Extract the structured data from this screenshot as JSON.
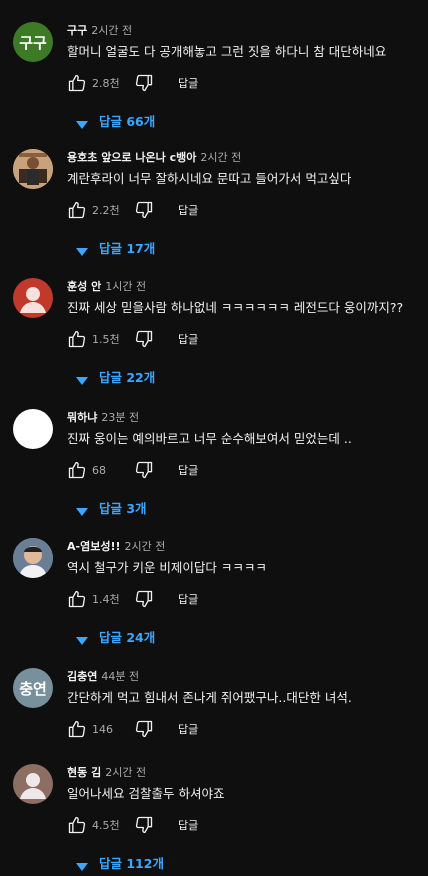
{
  "comments": [
    {
      "author": "구구",
      "time": "2시간 전",
      "text": "할머니 얼굴도 다 공개해놓고 그런 짓을 하다니 참 대단하네요",
      "likes": "2.8천",
      "reply_label": "답글",
      "replies_label": "답글 66개",
      "avatar": {
        "type": "initials",
        "initials": "구구",
        "color": "#3d7a26"
      }
    },
    {
      "author": "용호초 앞으로 나온나 c뱅아",
      "time": "2시간 전",
      "text": "계란후라이 너무 잘하시네요 문따고 들어가서 먹고싶다",
      "likes": "2.2천",
      "reply_label": "답글",
      "replies_label": "답글 17개",
      "avatar": {
        "type": "photo",
        "color": "#c7a27a"
      }
    },
    {
      "author": "훈성 안",
      "time": "1시간 전",
      "text": "진짜 세상 믿을사람 하나없네 ㅋㅋㅋㅋㅋㅋ 레전드다 웅이까지??",
      "likes": "1.5천",
      "reply_label": "답글",
      "replies_label": "답글 22개",
      "avatar": {
        "type": "default-person",
        "color": "#c0392b"
      }
    },
    {
      "author": "뭐하냐",
      "time": "23분 전",
      "text": "진짜 웅이는 예의바르고 너무 순수해보여서 믿었는데 ..",
      "likes": "68",
      "reply_label": "답글",
      "replies_label": "답글 3개",
      "avatar": {
        "type": "blank",
        "color": "#ffffff"
      }
    },
    {
      "author": "A-염보성!!",
      "time": "2시간 전",
      "text": "역시 철구가 키운 비제이답다 ㅋㅋㅋㅋ",
      "likes": "1.4천",
      "reply_label": "답글",
      "replies_label": "답글 24개",
      "avatar": {
        "type": "photo",
        "color": "#6a7f96"
      }
    },
    {
      "author": "김충연",
      "time": "44분 전",
      "text": "간단하게 먹고 힘내서 존나게 쥐어팼구나..대단한 녀석.",
      "likes": "146",
      "reply_label": "답글",
      "replies_label": "",
      "avatar": {
        "type": "initials",
        "initials": "충연",
        "color": "#78909c"
      }
    },
    {
      "author": "현동 김",
      "time": "2시간 전",
      "text": "일어나세요 검찰출두 하셔야죠",
      "likes": "4.5천",
      "reply_label": "답글",
      "replies_label": "답글 112개",
      "avatar": {
        "type": "default-person",
        "color": "#8d6e63"
      }
    }
  ],
  "colors": {
    "background": "#0f0f0f",
    "text": "#f1f1f1",
    "secondary": "#aaaaaa",
    "link": "#3ea6ff"
  }
}
